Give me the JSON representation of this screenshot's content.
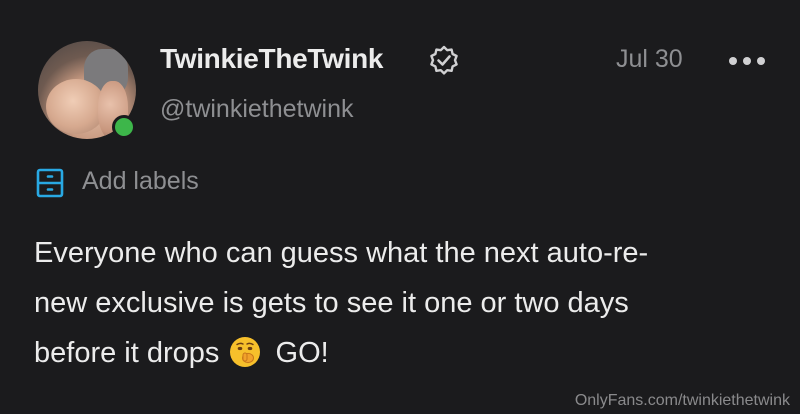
{
  "post": {
    "display_name": "TwinkieTheTwink",
    "handle": "@twinkiethetwink",
    "date": "Jul 30",
    "labels_label": "Add labels",
    "text_lines": [
      "Everyone who can guess what the next auto-re-",
      "new exclusive is gets to see it one or two days",
      "before it drops",
      "GO!"
    ]
  },
  "icons": {
    "verified": "verified-badge-icon",
    "more": "more-options-icon",
    "labels": "labels-icon",
    "emoji": "shushing-face-emoji"
  },
  "colors": {
    "background": "#1b1b1d",
    "text": "#ececec",
    "muted": "#8e8f92",
    "accent": "#29a9e4",
    "online": "#3db64a"
  },
  "watermark": "OnlyFans.com/twinkiethetwink"
}
